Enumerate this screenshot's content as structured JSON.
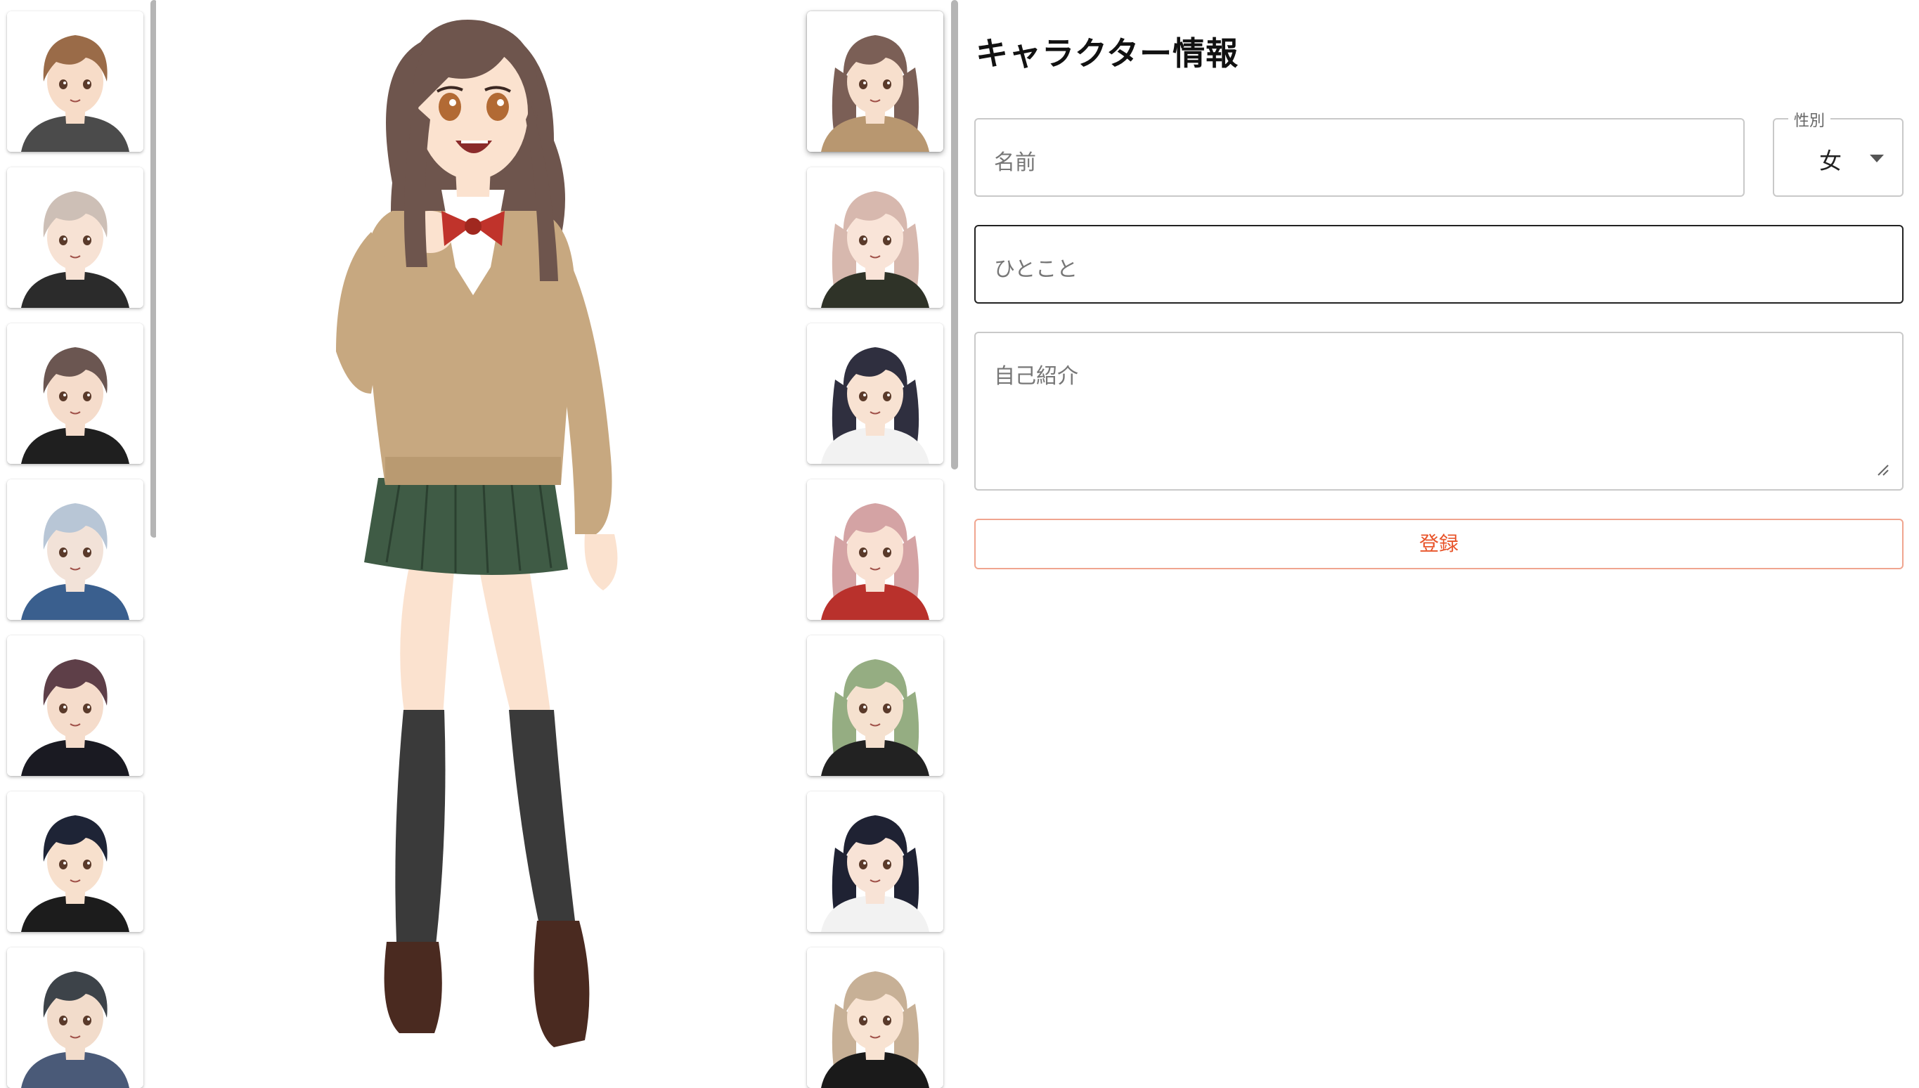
{
  "panel": {
    "title": "キャラクター情報",
    "name_placeholder": "名前",
    "gender_label": "性別",
    "gender_value": "女",
    "hitokoto_placeholder": "ひとこと",
    "intro_placeholder": "自己紹介",
    "submit_label": "登録"
  },
  "left_characters": [
    {
      "hair": "#9a6b48",
      "outfit": "#4b4b4b",
      "skin": "#f7dcc8"
    },
    {
      "hair": "#cdbfb6",
      "outfit": "#2b2b2b",
      "skin": "#f7e2d4"
    },
    {
      "hair": "#6b5651",
      "outfit": "#1f1f1f",
      "skin": "#f5dccb"
    },
    {
      "hair": "#b8c6d6",
      "outfit": "#3a5f8e",
      "skin": "#f2e2d8"
    },
    {
      "hair": "#5e3f48",
      "outfit": "#1a1a22",
      "skin": "#f5dccb"
    },
    {
      "hair": "#1e2436",
      "outfit": "#1c1c1c",
      "skin": "#f7e0cd"
    },
    {
      "hair": "#3d4349",
      "outfit": "#4a5a78",
      "skin": "#f2dccb"
    }
  ],
  "right_characters": [
    {
      "hair": "#7b5f56",
      "outfit": "#b89770",
      "skin": "#f7dfcd",
      "selected": true
    },
    {
      "hair": "#d7b8ae",
      "outfit": "#2f3328",
      "skin": "#f9e4d8",
      "selected": false
    },
    {
      "hair": "#2f2f3f",
      "outfit": "#f2f2f2",
      "skin": "#f8e2d2",
      "selected": false
    },
    {
      "hair": "#d4a3a4",
      "outfit": "#b9312c",
      "skin": "#f9e1d3",
      "selected": false
    },
    {
      "hair": "#95ad82",
      "outfit": "#222222",
      "skin": "#f5e1cf",
      "selected": false
    },
    {
      "hair": "#1f2233",
      "outfit": "#f2f2f2",
      "skin": "#f8e3d6",
      "selected": false
    },
    {
      "hair": "#c7b096",
      "outfit": "#1a1a1a",
      "skin": "#f8e3d2",
      "selected": false
    }
  ],
  "preview": {
    "hair": "#6e554d",
    "sweater": "#c7a880",
    "skirt": "#3f5b45",
    "socks": "#3a3a3a",
    "shoes": "#4a2a20",
    "bow": "#c0332b",
    "skin": "#fbe2cf",
    "eye": "#b26a34"
  }
}
